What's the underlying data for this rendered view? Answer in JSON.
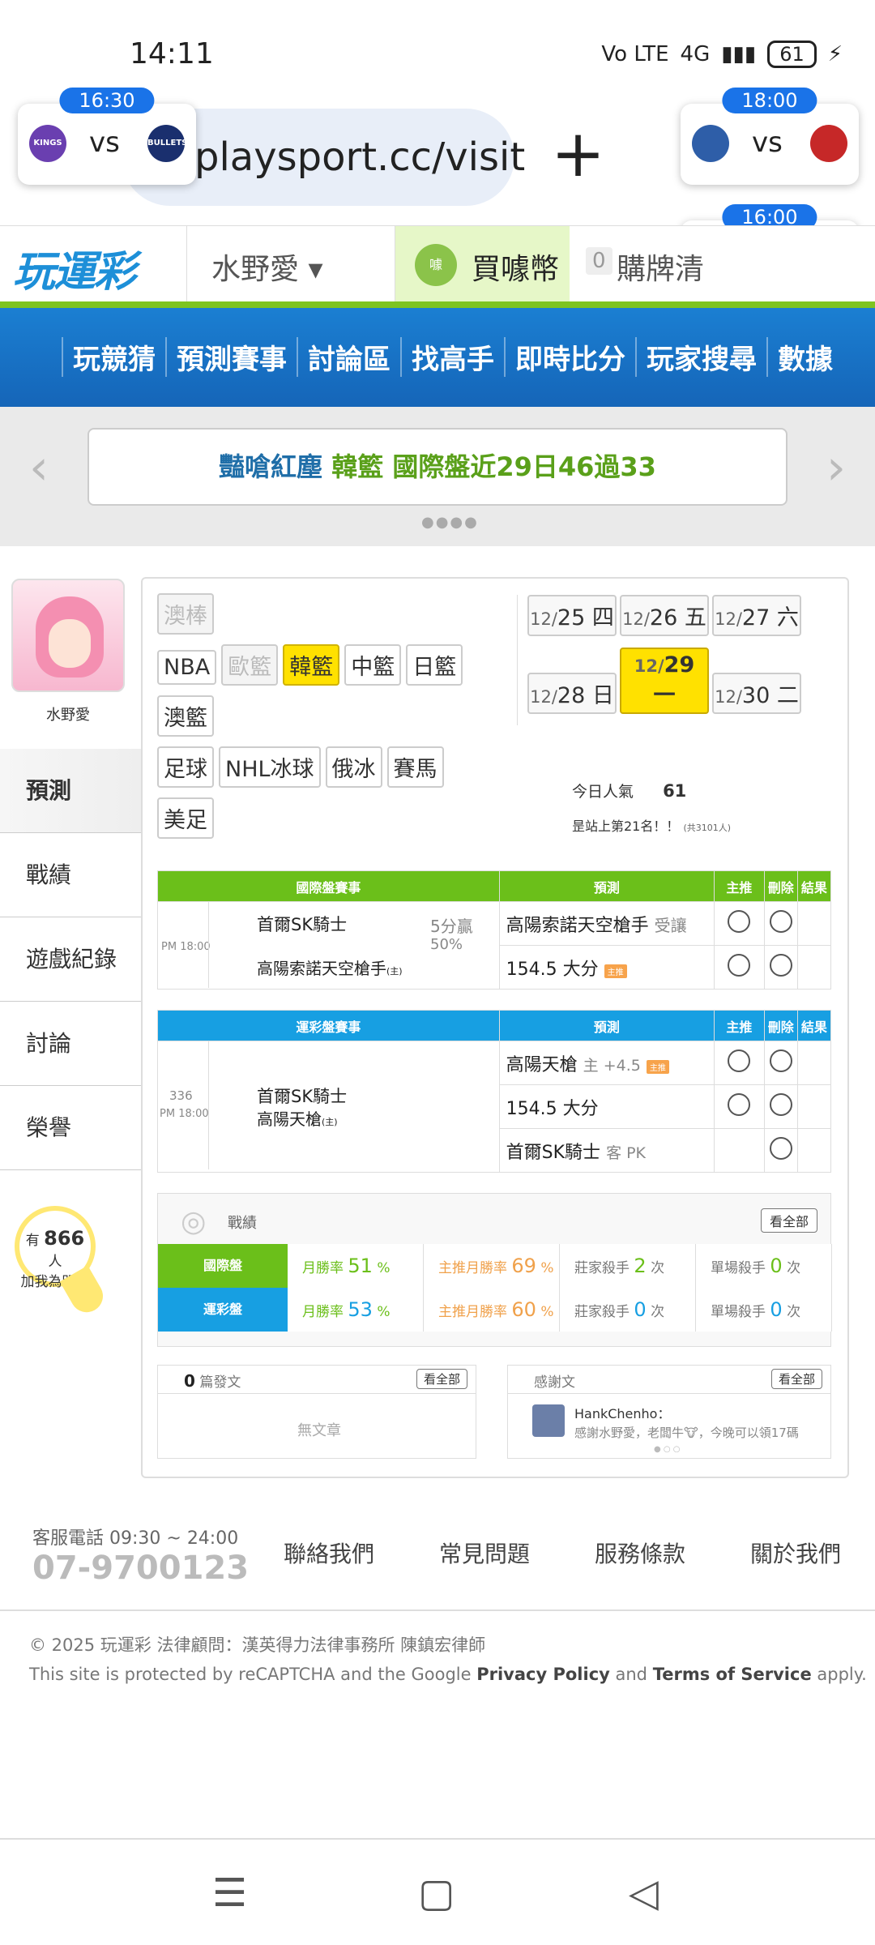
{
  "status": {
    "time": "14:11",
    "signal": "4G",
    "battery": "61"
  },
  "browser": {
    "url": "playsport.cc/visit",
    "new_tab": "+"
  },
  "score_cards": [
    {
      "time": "16:30",
      "vs": "vs",
      "home": "KINGS",
      "away": "BULLETS"
    },
    {
      "time": "18:00",
      "vs": "vs",
      "home": "",
      "away": ""
    },
    {
      "time": "16:00",
      "vs": "vs",
      "home": "",
      "away": ""
    }
  ],
  "header": {
    "brand": "玩運彩",
    "user": "水野愛 ▾",
    "coin": "買噱幣",
    "coin_count": "0",
    "buy_card": "購牌清"
  },
  "nav": [
    "玩競猜",
    "預測賽事",
    "討論區",
    "找高手",
    "即時比分",
    "玩家搜尋",
    "數據"
  ],
  "banner": {
    "part1": "豔嗆紅塵",
    "part2": "韓籃",
    "part3": "國際盤近29日46過33"
  },
  "profile": {
    "name": "水野愛"
  },
  "sidemenu": [
    "預測",
    "戰績",
    "遊戲紀錄",
    "討論",
    "榮譽"
  ],
  "fans": {
    "prefix": "有",
    "count": "866",
    "unit": "人",
    "suffix": "加我為明燈"
  },
  "league_tags": [
    {
      "label": "澳棒",
      "state": "dis"
    },
    {
      "label": "NBA",
      "state": ""
    },
    {
      "label": "歐籃",
      "state": "dis"
    },
    {
      "label": "韓籃",
      "state": "sel"
    },
    {
      "label": "中籃",
      "state": ""
    },
    {
      "label": "日籃",
      "state": ""
    },
    {
      "label": "澳籃",
      "state": ""
    },
    {
      "label": "足球",
      "state": ""
    },
    {
      "label": "NHL冰球",
      "state": ""
    },
    {
      "label": "俄冰",
      "state": ""
    },
    {
      "label": "賽馬",
      "state": ""
    },
    {
      "label": "美足",
      "state": ""
    }
  ],
  "dates": [
    {
      "m": "12/",
      "d": "25 四",
      "sel": false
    },
    {
      "m": "12/",
      "d": "26 五",
      "sel": false
    },
    {
      "m": "12/",
      "d": "27 六",
      "sel": false
    },
    {
      "m": "12/",
      "d": "28 日",
      "sel": false
    },
    {
      "m": "12/",
      "d": "29 一",
      "sel": true
    },
    {
      "m": "12/",
      "d": "30 二",
      "sel": false
    }
  ],
  "popularity": {
    "label": "今日人氣",
    "value": "61",
    "rank": "昰站上第21名！！",
    "total": "(共3101人)"
  },
  "intl_table": {
    "headers": [
      "國際盤賽事",
      "預測",
      "主推",
      "刪除",
      "結果"
    ],
    "time": "PM 18:00",
    "team1": "首爾SK騎士",
    "team2": "高陽索諾天空槍手",
    "home_mark": "(主)",
    "line": "5分贏",
    "line2": "50%",
    "pred1": "高陽索諾天空槍手",
    "pred1_sub": "受讓",
    "pred2": "154.5 大分",
    "pred2_tag": "主推"
  },
  "lottery_table": {
    "headers": [
      "運彩盤賽事",
      "預測",
      "主推",
      "刪除",
      "結果"
    ],
    "no": "336",
    "time": "PM 18:00",
    "team1": "首爾SK騎士",
    "team2": "高陽天槍",
    "home_mark": "(主)",
    "pred1": "高陽天槍",
    "pred1_sub": "主 +4.5",
    "pred1_tag": "主推",
    "pred2": "154.5 大分",
    "pred3": "首爾SK騎士",
    "pred3_sub": "客 PK"
  },
  "record": {
    "title": "戰績",
    "more": "看全部",
    "rows": [
      {
        "label": "國際盤",
        "rate_label": "月勝率",
        "rate": "51",
        "main_label": "主推月勝率",
        "main": "69",
        "killer_label": "莊家殺手",
        "killer": "2",
        "killer_unit": "次",
        "single_label": "單場殺手",
        "single": "0",
        "single_unit": "次"
      },
      {
        "label": "運彩盤",
        "rate_label": "月勝率",
        "rate": "53",
        "main_label": "主推月勝率",
        "main": "60",
        "killer_label": "莊家殺手",
        "killer": "0",
        "killer_unit": "次",
        "single_label": "單場殺手",
        "single": "0",
        "single_unit": "次"
      }
    ],
    "pct": "%"
  },
  "posts": {
    "count": "0",
    "label": "篇發文",
    "more": "看全部",
    "empty": "無文章"
  },
  "thanks": {
    "label": "感謝文",
    "more": "看全部",
    "user": "HankChenho：",
    "text": "感謝水野愛，老闆牛🐮，今晚可以領17碼"
  },
  "footer": {
    "service": "客服電話 09:30 ~ 24:00",
    "phone": "07-9700123",
    "links": [
      "聯絡我們",
      "常見問題",
      "服務條款",
      "關於我們"
    ],
    "copyright": "© 2025 玩運彩 法律顧問：漢英得力法律事務所 陳鎮宏律師",
    "recaptcha_a": "This site is protected by reCAPTCHA and the Google ",
    "privacy": "Privacy Policy",
    "and": " and ",
    "terms": "Terms of Service",
    "apply": " apply."
  },
  "sysnav": {
    "menu": "☰",
    "home": "▢",
    "back": "◁"
  }
}
